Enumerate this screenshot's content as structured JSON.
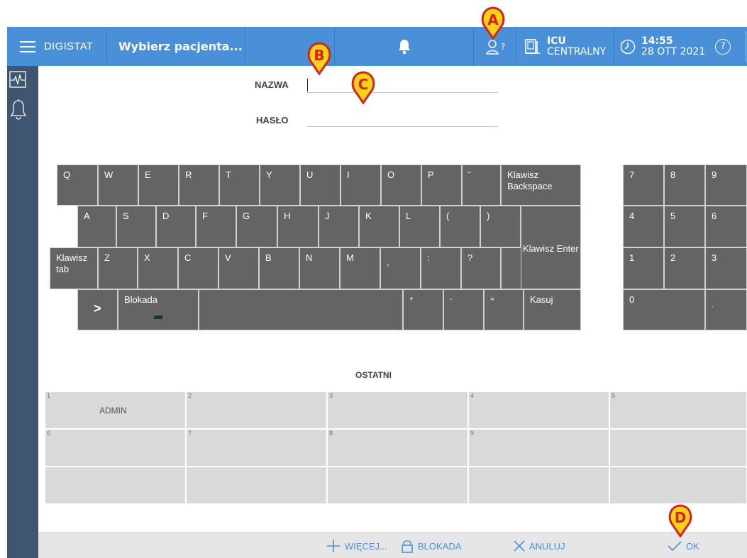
{
  "topbar": {
    "app_name": "DIGISTAT",
    "patient": "Wybierz pacjenta...",
    "user_indicator": "?",
    "ward_line1": "ICU",
    "ward_line2": "CENTRALNY",
    "time": "14:55",
    "date": "28 OTT 2021",
    "help": "?"
  },
  "sidebar": {
    "icons": [
      "monitor-icon",
      "bell-icon"
    ]
  },
  "form": {
    "name_label": "NAZWA",
    "name_value": "",
    "password_label": "HASŁO",
    "password_value": ""
  },
  "keyboard": {
    "row1": [
      "Q",
      "W",
      "E",
      "R",
      "T",
      "Y",
      "U",
      "I",
      "O",
      "P",
      "\"",
      "Klawisz Backspace"
    ],
    "row2": [
      "A",
      "S",
      "D",
      "F",
      "G",
      "H",
      "J",
      "K",
      "L",
      "(",
      ")"
    ],
    "row3": [
      "Klawisz tab",
      "Z",
      "X",
      "C",
      "V",
      "B",
      "N",
      "M",
      ",",
      ":",
      "?"
    ],
    "enter": "Klawisz Enter",
    "row4": [
      ">",
      "Blokada",
      "",
      "+",
      "-",
      "=",
      "Kasuj"
    ],
    "numpad": [
      "7",
      "8",
      "9",
      "4",
      "5",
      "6",
      "1",
      "2",
      "3",
      "0",
      "."
    ]
  },
  "recent": {
    "title": "OSTATNI",
    "cells": [
      {
        "num": "1",
        "name": "ADMIN"
      },
      {
        "num": "2",
        "name": ""
      },
      {
        "num": "3",
        "name": ""
      },
      {
        "num": "4",
        "name": ""
      },
      {
        "num": "5",
        "name": ""
      },
      {
        "num": "6",
        "name": ""
      },
      {
        "num": "7",
        "name": ""
      },
      {
        "num": "8",
        "name": ""
      },
      {
        "num": "9",
        "name": ""
      },
      {
        "num": "",
        "name": ""
      },
      {
        "num": "",
        "name": ""
      },
      {
        "num": "",
        "name": ""
      },
      {
        "num": "",
        "name": ""
      },
      {
        "num": "",
        "name": ""
      },
      {
        "num": "",
        "name": ""
      }
    ]
  },
  "bottombar": {
    "more": "WIĘCEJ...",
    "lock": "BLOKADA",
    "cancel": "ANULUJ",
    "ok": "OK"
  },
  "markers": [
    "A",
    "B",
    "C",
    "D"
  ],
  "colors": {
    "topbar": "#4a90d9",
    "sidebar": "#3f5670",
    "key": "#646464",
    "marker_fill": "#f7d417",
    "marker_stroke": "#d9201b"
  }
}
